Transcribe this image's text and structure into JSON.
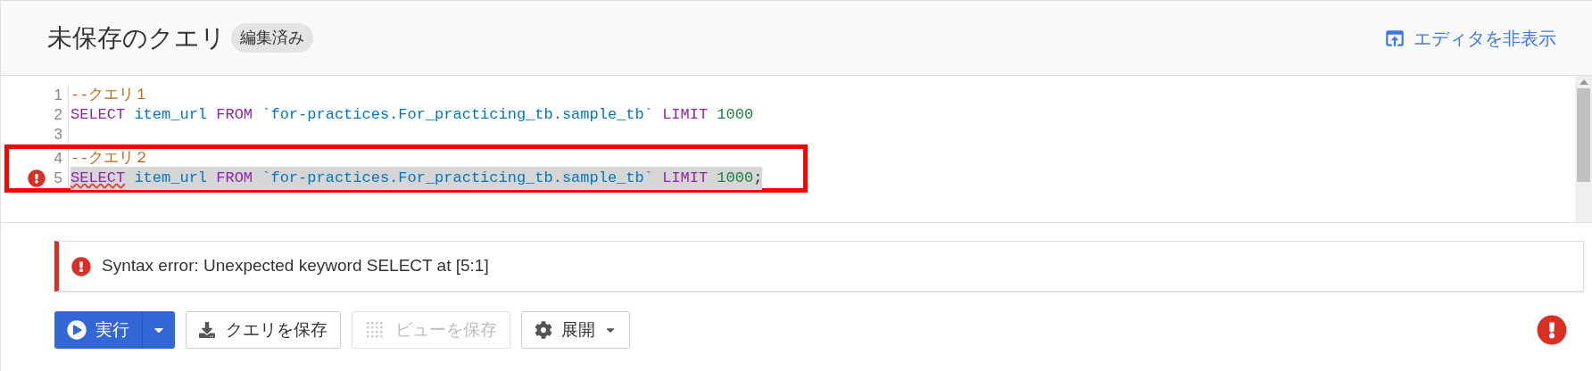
{
  "header": {
    "title": "未保存のクエリ",
    "badge": "編集済み",
    "hide_editor_link": "エディタを非表示"
  },
  "editor": {
    "lines": [
      {
        "number": "1",
        "error": false,
        "highlighted": false,
        "boxed": false,
        "tokens": [
          {
            "text": "--クエリ１",
            "kind": "comment",
            "error": false
          }
        ]
      },
      {
        "number": "2",
        "error": false,
        "highlighted": false,
        "boxed": false,
        "tokens": [
          {
            "text": "SELECT",
            "kind": "keyword",
            "error": false
          },
          {
            "text": " item_url ",
            "kind": "identifier",
            "error": false
          },
          {
            "text": "FROM",
            "kind": "keyword",
            "error": false
          },
          {
            "text": " `for-practices.For_practicing_tb.sample_tb` ",
            "kind": "string",
            "error": false
          },
          {
            "text": "LIMIT",
            "kind": "keyword",
            "error": false
          },
          {
            "text": " 1000",
            "kind": "number",
            "error": false
          }
        ]
      },
      {
        "number": "3",
        "error": false,
        "highlighted": false,
        "boxed": false
      },
      {
        "number": "4",
        "error": false,
        "highlighted": false,
        "boxed": true,
        "tokens": [
          {
            "text": "--クエリ２",
            "kind": "comment",
            "error": false
          }
        ]
      },
      {
        "number": "5",
        "error": true,
        "highlighted": true,
        "boxed": true,
        "tokens": [
          {
            "text": "SELECT",
            "kind": "keyword",
            "error": true
          },
          {
            "text": " item_url ",
            "kind": "identifier",
            "error": false
          },
          {
            "text": "FROM",
            "kind": "keyword",
            "error": false
          },
          {
            "text": " `for-practices.For_practicing_tb.sample_tb` ",
            "kind": "string",
            "error": false
          },
          {
            "text": "LIMIT",
            "kind": "keyword",
            "error": false
          },
          {
            "text": " 1000",
            "kind": "number",
            "error": false
          },
          {
            "text": ";",
            "kind": "punct",
            "error": false
          }
        ]
      }
    ]
  },
  "error_message": "Syntax error: Unexpected keyword SELECT at [5:1]",
  "toolbar": [
    {
      "kind": "run",
      "label": "実行",
      "disabled": false
    },
    {
      "kind": "save",
      "label": "クエリを保存",
      "disabled": false
    },
    {
      "kind": "view",
      "label": "ビューを保存",
      "disabled": true
    },
    {
      "kind": "more",
      "label": "展開",
      "disabled": false
    }
  ],
  "status": {
    "error": true
  }
}
